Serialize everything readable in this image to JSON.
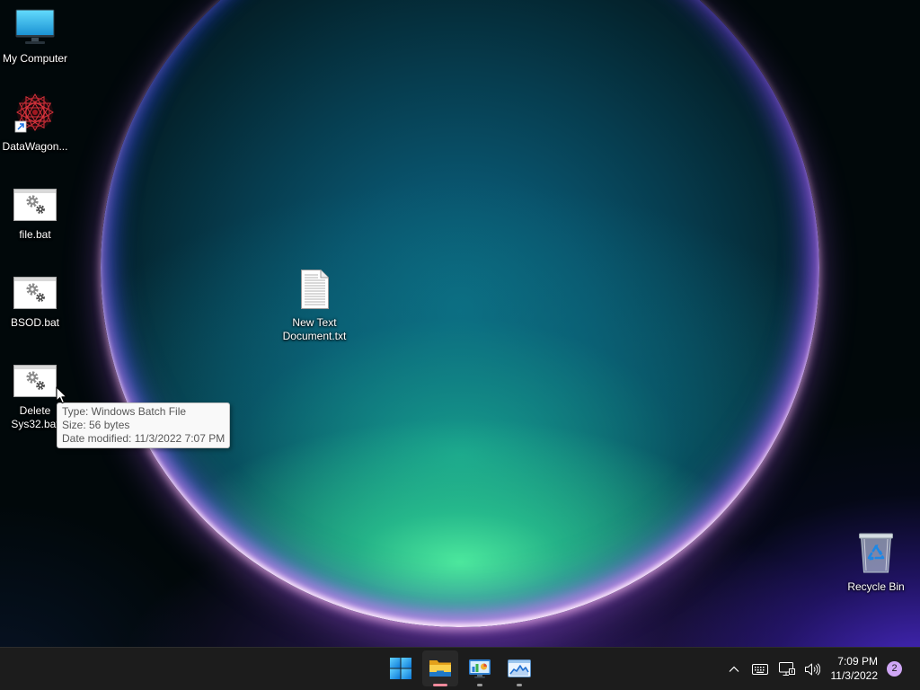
{
  "desktop": {
    "icons": [
      {
        "label": "My Computer",
        "icon": "computer-icon"
      },
      {
        "label": "DataWagon...",
        "icon": "datawagon-app-icon",
        "overlay": "shortcut-arrow-icon"
      },
      {
        "label": "file.bat",
        "icon": "batch-file-icon"
      },
      {
        "label": "BSOD.bat",
        "icon": "batch-file-icon"
      },
      {
        "label": "Delete Sys32.bat",
        "icon": "batch-file-icon"
      },
      {
        "label": "New Text Document.txt",
        "icon": "text-document-icon"
      },
      {
        "label": "Recycle Bin",
        "icon": "recycle-bin-icon"
      }
    ]
  },
  "tooltip": {
    "lines": [
      "Type: Windows Batch File",
      "Size: 56 bytes",
      "Date modified: 11/3/2022 7:07 PM"
    ]
  },
  "taskbar": {
    "pinned": [
      {
        "icon": "windows-start-icon",
        "running": false,
        "active": false
      },
      {
        "icon": "file-explorer-icon",
        "running": true,
        "active": true
      },
      {
        "icon": "control-panel-icon",
        "running": true,
        "active": false
      },
      {
        "icon": "task-manager-icon",
        "running": true,
        "active": false
      }
    ],
    "tray": {
      "icons": [
        "chevron-up-icon",
        "keyboard-icon",
        "network-icon",
        "volume-icon"
      ],
      "time": "7:09 PM",
      "date": "11/3/2022",
      "notification_count": "2"
    }
  },
  "colors": {
    "taskbar_background": "#1c1c1c",
    "active_indicator": "#f08a9c",
    "running_indicator": "#9a9a9a",
    "notification_badge": "#cfa6f5",
    "tooltip_background": "#f9f9f9",
    "tooltip_text": "#575757"
  }
}
